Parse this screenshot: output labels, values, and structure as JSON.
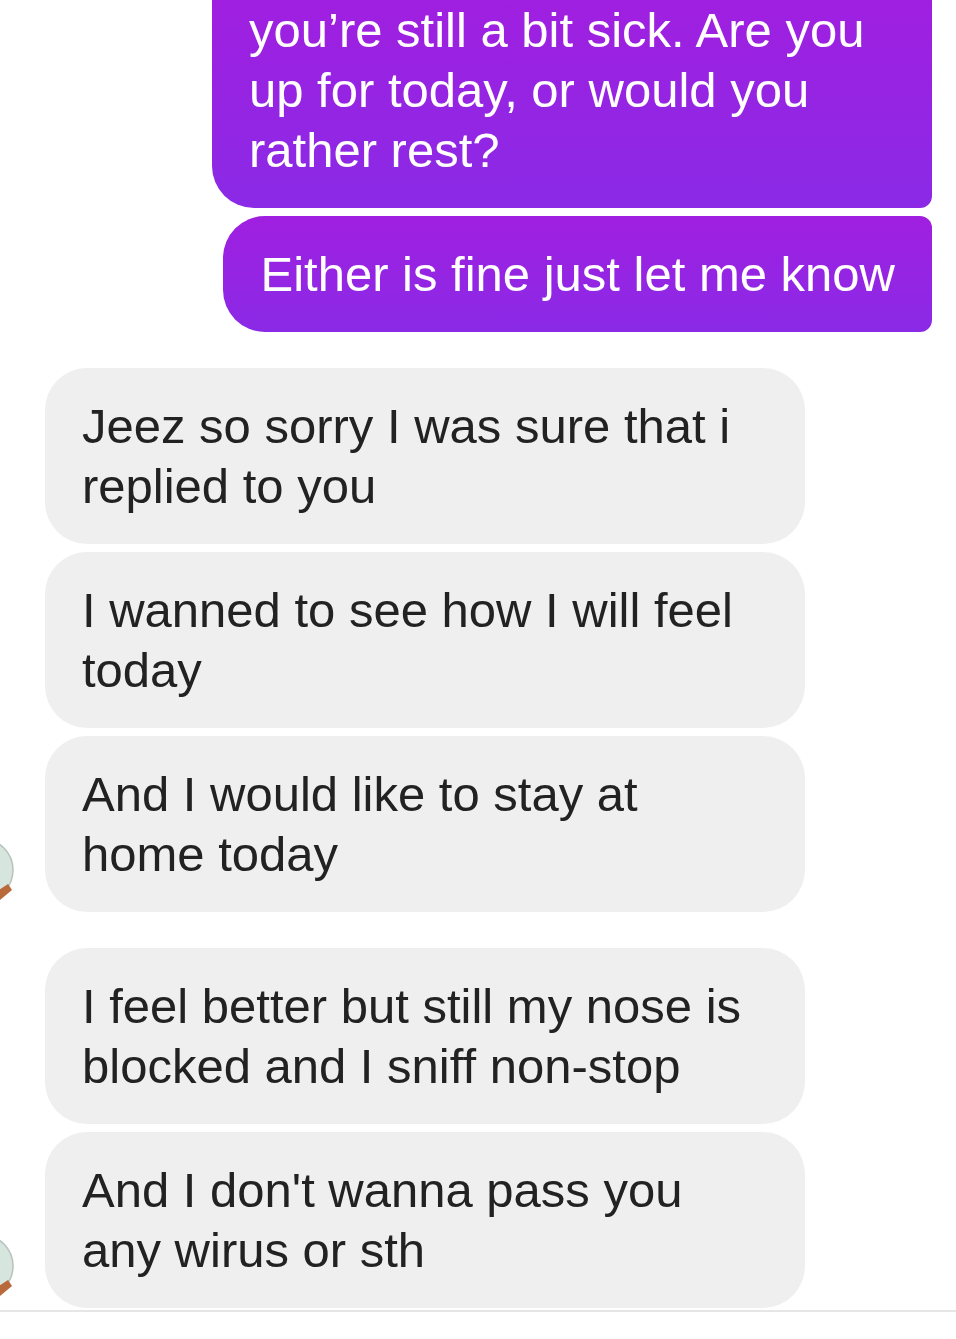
{
  "messages": [
    {
      "kind": "sent",
      "text": "you’re still a bit sick. Are you up for today, or would you rather rest?"
    },
    {
      "kind": "sent",
      "text": "Either is fine just let me know"
    },
    {
      "kind": "received",
      "text": "Jeez so sorry I was sure that i replied to you",
      "avatar": false
    },
    {
      "kind": "received",
      "text": "I wanned to see how I will feel today",
      "avatar": false
    },
    {
      "kind": "received",
      "text": "And I would like to stay at home today",
      "avatar": true
    },
    {
      "kind": "received",
      "text": "I feel better but still my nose is blocked and I sniff non-stop",
      "avatar": false
    },
    {
      "kind": "received",
      "text": "And I don't wanna pass you any wirus or sth",
      "avatar": true
    }
  ]
}
